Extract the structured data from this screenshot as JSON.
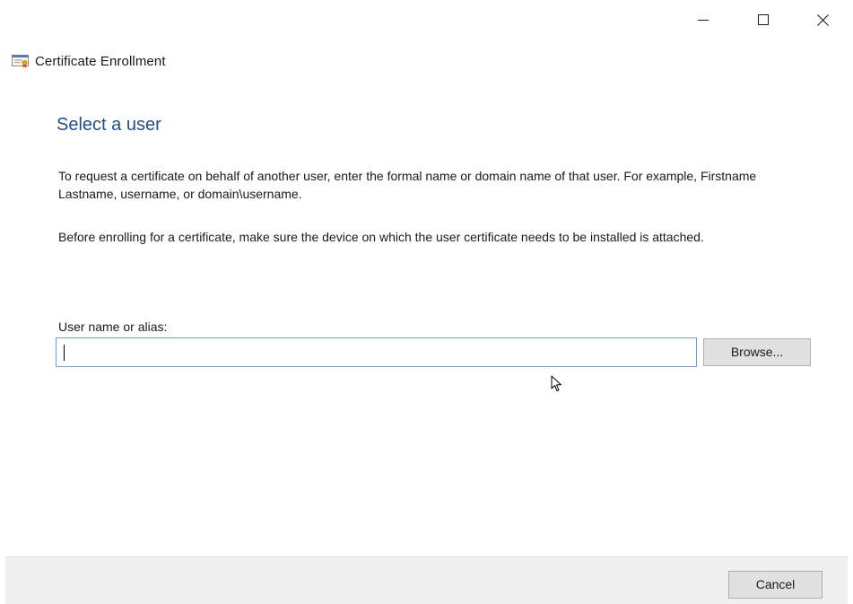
{
  "window": {
    "title": "Certificate Enrollment",
    "controls": {
      "minimize_icon": "minimize-icon",
      "maximize_icon": "maximize-icon",
      "close_icon": "close-icon"
    }
  },
  "page": {
    "heading": "Select a user",
    "paragraph1": "To request a certificate on behalf of another user, enter the formal name or domain name of that user. For example, Firstname Lastname, username, or domain\\username.",
    "paragraph2": "Before enrolling for a certificate, make sure the device on which the user certificate needs to be installed is attached.",
    "user_field": {
      "label": "User name or alias:",
      "value": "",
      "placeholder": ""
    },
    "browse_label": "Browse..."
  },
  "footer": {
    "cancel_label": "Cancel"
  },
  "colors": {
    "heading": "#1f4e8c",
    "input_border": "#7a9bc7",
    "button_bg": "#e1e1e1",
    "footer_bg": "#f0f0f0"
  }
}
